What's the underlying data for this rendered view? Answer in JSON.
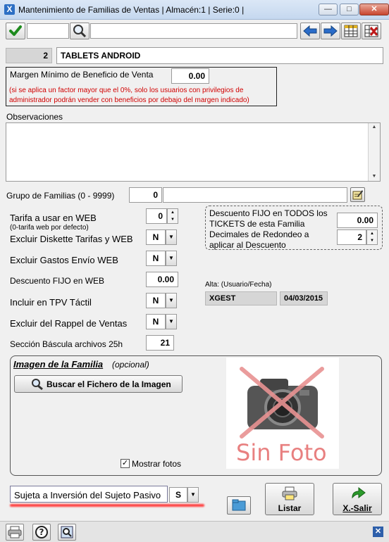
{
  "window": {
    "title": "Mantenimiento de Familias de Ventas   | Almacén:1 | Serie:0 |",
    "minimize": "—",
    "maximize": "□",
    "close": "✕",
    "app_icon": "X"
  },
  "toolbar": {
    "confirm_icon": "check-icon",
    "search_icon": "search-icon",
    "code_value": "",
    "description_value": ""
  },
  "record": {
    "code": "2",
    "name": "TABLETS ANDROID"
  },
  "margin": {
    "label": "Margen Mínimo de Beneficio de Venta",
    "value": "0.00",
    "note": "(si se aplica un factor mayor que el 0%, solo los usuarios con privilegios de administrador podrán vender con beneficios por debajo del margen indicado)"
  },
  "observations": {
    "label": "Observaciones",
    "value": ""
  },
  "group": {
    "label": "Grupo de Familias (0 - 9999)",
    "code": "0",
    "name": ""
  },
  "web": {
    "tariff_label": "Tarifa a usar en WEB",
    "tariff_hint": "(0-tarifa web por defecto)",
    "tariff_value": "0",
    "exclude_diskette_label": "Excluir Diskette Tarifas y WEB",
    "exclude_diskette_value": "N",
    "exclude_shipping_label": "Excluir Gastos Envío WEB",
    "exclude_shipping_value": "N",
    "fixed_discount_label": "Descuento FIJO en WEB",
    "fixed_discount_value": "0.00",
    "tpv_label": "Incluir en TPV Táctil",
    "tpv_value": "N",
    "rappel_label": "Excluir del Rappel de Ventas",
    "rappel_value": "N",
    "scale_label": "Sección Báscula archivos 25h",
    "scale_value": "21"
  },
  "discount_box": {
    "label1": "Descuento FIJO en TODOS los TICKETS de esta Familia",
    "value1": "0.00",
    "label2": "Decimales de Redondeo a aplicar al Descuento",
    "value2": "2"
  },
  "audit": {
    "label": "Alta: (Usuario/Fecha)",
    "user": "XGEST",
    "date": "04/03/2015"
  },
  "image": {
    "title": "Imagen de la Familia",
    "optional": "(opcional)",
    "search_button": "Buscar el Fichero de la Imagen",
    "placeholder_text": "Sin Foto",
    "show_photos_label": "Mostrar fotos",
    "show_photos_checked": true
  },
  "passive": {
    "label": "Sujeta a Inversión del Sujeto Pasivo",
    "value": "S"
  },
  "actions": {
    "list_label": "Listar",
    "exit_label": "X.-Salir"
  },
  "colors": {
    "accent_red": "#d10000",
    "highlight_red": "#ff4040"
  }
}
